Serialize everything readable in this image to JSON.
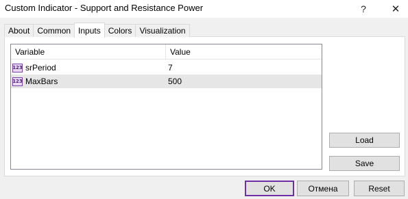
{
  "window": {
    "title": "Custom Indicator - Support and Resistance Power",
    "help_glyph": "?",
    "close_glyph": "✕"
  },
  "tabs": [
    {
      "label": "About"
    },
    {
      "label": "Common"
    },
    {
      "label": "Inputs",
      "active": true
    },
    {
      "label": "Colors"
    },
    {
      "label": "Visualization"
    }
  ],
  "grid": {
    "columns": {
      "variable": "Variable",
      "value": "Value"
    },
    "rows": [
      {
        "icon": "integer-icon",
        "icon_text": "123",
        "name": "srPeriod",
        "value": "7"
      },
      {
        "icon": "integer-icon",
        "icon_text": "123",
        "name": "MaxBars",
        "value": "500"
      }
    ]
  },
  "buttons": {
    "load": "Load",
    "save": "Save",
    "ok": "OK",
    "cancel": "Отмена",
    "reset": "Reset"
  },
  "colors": {
    "accent": "#6e2fa6",
    "selected_row": "#e6e6e6"
  }
}
